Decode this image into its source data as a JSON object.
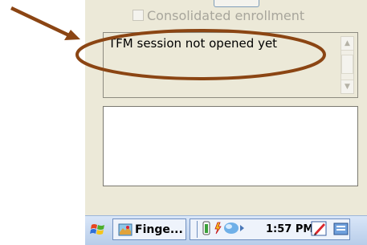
{
  "form": {
    "checkbox_label": "Consolidated enrollment",
    "checkbox_checked": false,
    "status_text": "TFM session not opened yet",
    "log_text": ""
  },
  "taskbar": {
    "app_label": "Finge...",
    "clock": "1:57 PM"
  },
  "icons": {
    "start": "windows-flag-icon",
    "app": "map-app-icon",
    "tray": [
      "battery-icon",
      "network-icon",
      "volume-icon"
    ],
    "pen": "pen-input-icon",
    "keyboard": "keyboard-icon"
  },
  "colors": {
    "annotation": "#8b4513",
    "taskbar": "#b8cde9",
    "form_background": "#ece9d8"
  }
}
